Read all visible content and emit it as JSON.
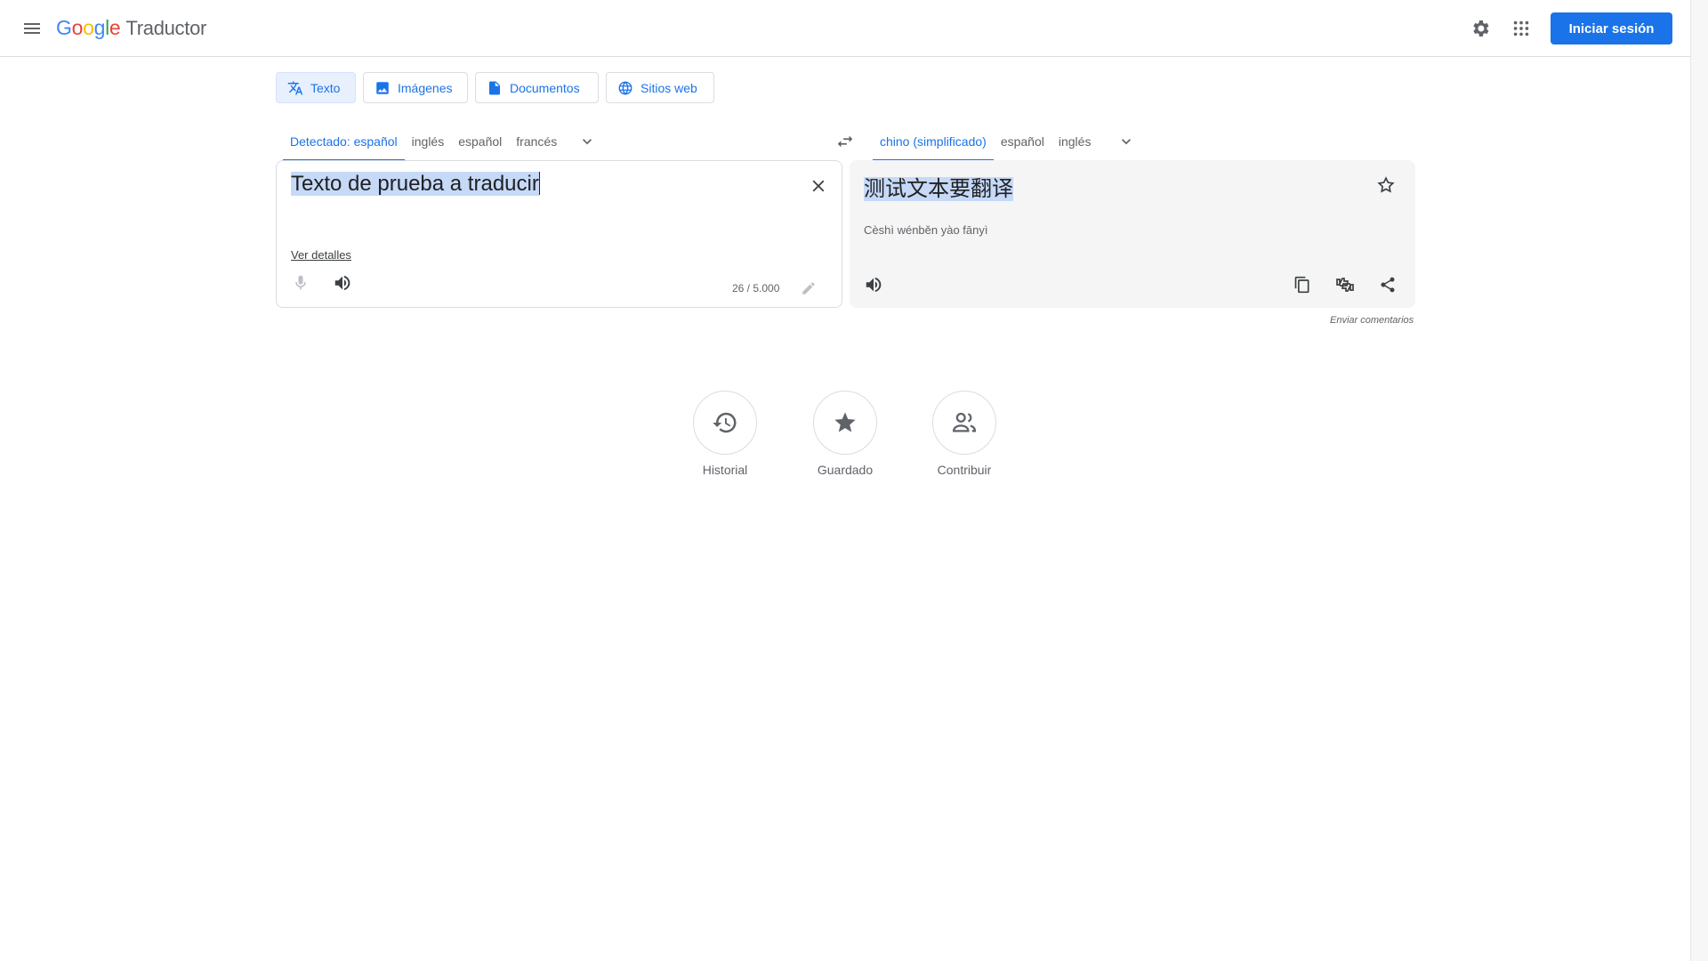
{
  "header": {
    "logo": {
      "letters": [
        "G",
        "o",
        "o",
        "g",
        "l",
        "e"
      ],
      "product": "Traductor"
    },
    "signin_label": "Iniciar sesión",
    "icons": [
      "menu-icon",
      "settings-icon",
      "apps-icon"
    ]
  },
  "mode_tabs": [
    {
      "label": "Texto",
      "icon": "translate-icon",
      "active": true
    },
    {
      "label": "Imágenes",
      "icon": "image-icon",
      "active": false
    },
    {
      "label": "Documentos",
      "icon": "document-icon",
      "active": false
    },
    {
      "label": "Sitios web",
      "icon": "globe-icon",
      "active": false
    }
  ],
  "source_langs": [
    {
      "label": "Detectado: español",
      "active": true
    },
    {
      "label": "inglés",
      "active": false
    },
    {
      "label": "español",
      "active": false
    },
    {
      "label": "francés",
      "active": false
    }
  ],
  "target_langs": [
    {
      "label": "chino (simplificado)",
      "active": true
    },
    {
      "label": "español",
      "active": false
    },
    {
      "label": "inglés",
      "active": false
    }
  ],
  "source": {
    "text": "Texto de prueba a traducir",
    "details_link": "Ver detalles",
    "char_count": "26 / 5.000"
  },
  "target": {
    "text": "测试文本要翻译",
    "transliteration": "Cèshì wénběn yào fānyì"
  },
  "feedback_label": "Enviar comentarios",
  "bottom_actions": [
    {
      "label": "Historial",
      "icon": "history-icon"
    },
    {
      "label": "Guardado",
      "icon": "star-filled-icon"
    },
    {
      "label": "Contribuir",
      "icon": "people-icon"
    }
  ],
  "colors": {
    "accent": "#1a73e8",
    "active_tab_bg": "#e8f0fe",
    "target_panel_bg": "#f5f5f5",
    "selection": "#c6d9f7"
  }
}
